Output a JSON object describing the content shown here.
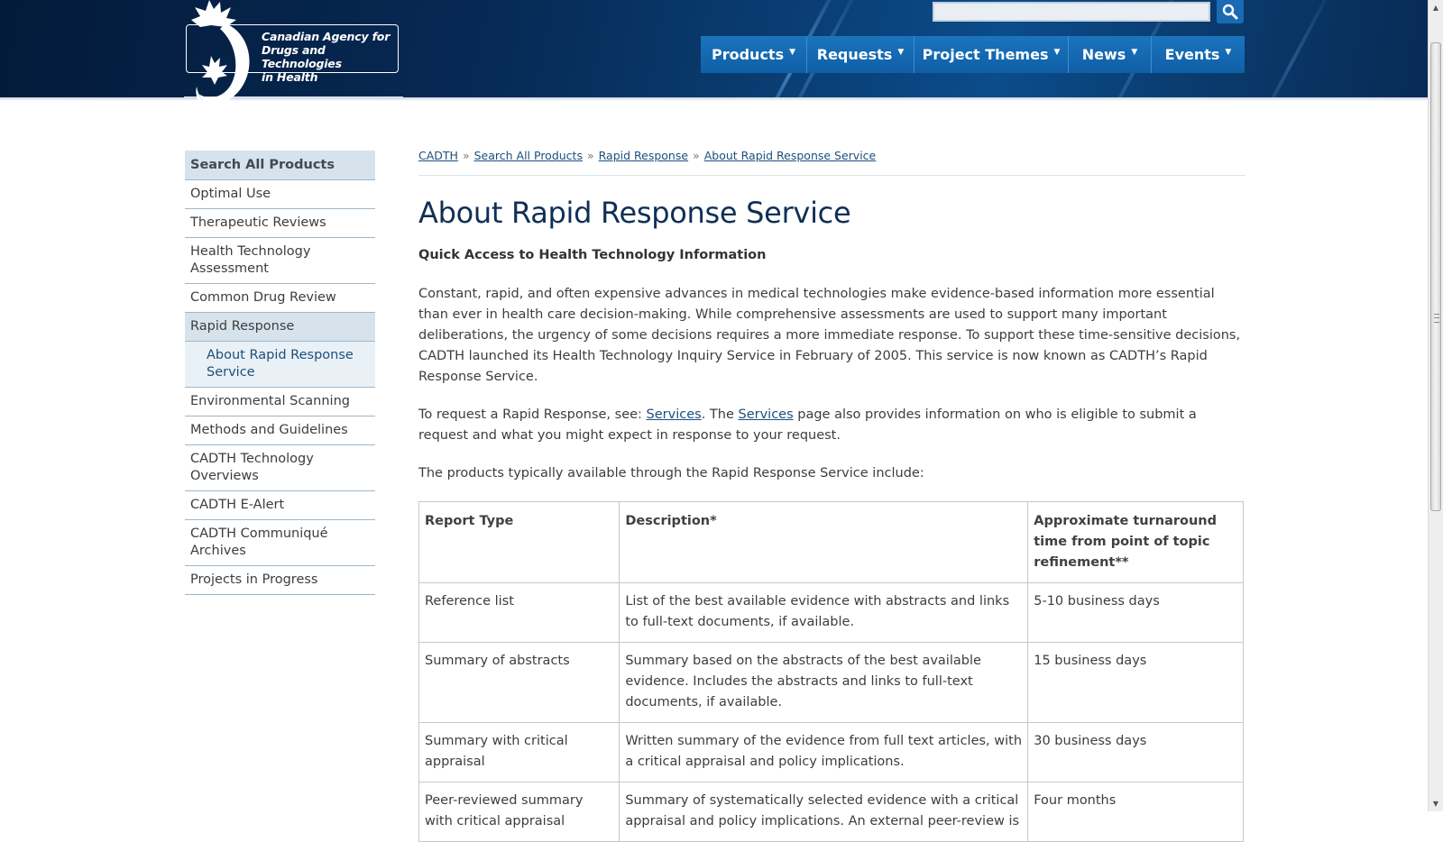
{
  "header": {
    "logo_text_lines": [
      "Canadian Agency for",
      "Drugs and Technologies",
      "in Health"
    ],
    "search": {
      "value": "",
      "placeholder": ""
    },
    "search_button_icon": "magnifier-icon",
    "nav": [
      {
        "label": "Products"
      },
      {
        "label": "Requests"
      },
      {
        "label": "Project Themes"
      },
      {
        "label": "News"
      },
      {
        "label": "Events"
      }
    ],
    "colors": {
      "header_dark": "#041a3a",
      "nav_blue": "#1b74bd"
    }
  },
  "sidebar": {
    "items": [
      {
        "label": "Search All Products"
      },
      {
        "label": "Optimal Use"
      },
      {
        "label": "Therapeutic Reviews"
      },
      {
        "label": "Health Technology Assessment"
      },
      {
        "label": "Common Drug Review"
      },
      {
        "label": "Rapid Response"
      },
      {
        "label": "About Rapid Response Service"
      },
      {
        "label": "Environmental Scanning"
      },
      {
        "label": "Methods and Guidelines"
      },
      {
        "label": "CADTH Technology Overviews"
      },
      {
        "label": "CADTH E-Alert"
      },
      {
        "label": "CADTH Communiqué Archives"
      },
      {
        "label": "Projects in Progress"
      }
    ]
  },
  "breadcrumb": {
    "items": [
      "CADTH",
      "Search All Products",
      "Rapid Response",
      "About Rapid Response Service"
    ],
    "separator": "»"
  },
  "page": {
    "title": "About Rapid Response Service",
    "lead": "Quick Access to Health Technology Information",
    "para1": "Constant, rapid, and often expensive advances in medical technologies make evidence-based information more essential than ever in health care decision-making. While comprehensive assessments are used to support many important deliberations, the urgency of some decisions requires a more immediate response. To support these time-sensitive decisions, CADTH launched its Health Technology Inquiry Service in February of 2005. This service is now known as CADTH’s Rapid Response Service.",
    "para2": {
      "part1": "To request a Rapid Response, see: ",
      "link1": "Services",
      "part2": ". The ",
      "link2": "Services",
      "part3": " page also provides information on who is eligible to submit a request and what you might expect in response to your request."
    },
    "para3": "The products typically available through the Rapid Response Service include:"
  },
  "table": {
    "headers": [
      "Report Type",
      "Description*",
      "Approximate turnaround time from point of topic refinement**"
    ],
    "rows": [
      [
        "Reference list",
        "List of the best available evidence with abstracts and links to full-text documents, if available.",
        "5-10 business days"
      ],
      [
        "Summary of abstracts",
        "Summary based on the abstracts of the best available evidence. Includes the abstracts and links to full-text documents, if available.",
        "15 business days"
      ],
      [
        "Summary with critical appraisal",
        "Written summary of the evidence from full text articles, with a critical appraisal and policy implications.",
        "30 business days"
      ],
      [
        "Peer-reviewed summary with critical appraisal",
        "Summary of systematically selected evidence with a critical appraisal and policy implications. An external peer-review is",
        "Four months"
      ]
    ]
  }
}
